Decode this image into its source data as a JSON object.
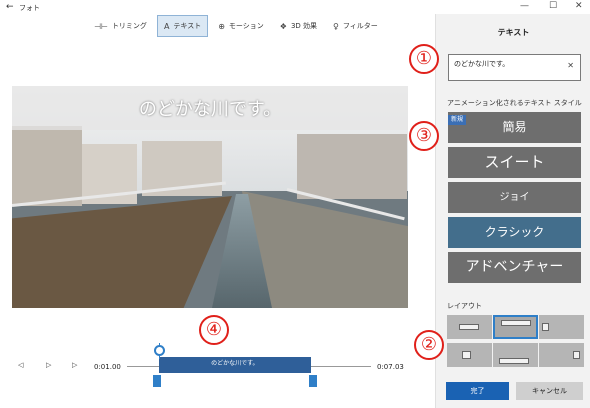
{
  "window": {
    "title": "フォト",
    "back_glyph": "←",
    "minimize": "—",
    "maximize": "☐",
    "close": "✕"
  },
  "toolbar": {
    "items": [
      {
        "label": "トリミング",
        "icon": "trim-icon"
      },
      {
        "label": "テキスト",
        "icon": "text-icon"
      },
      {
        "label": "モーション",
        "icon": "motion-icon"
      },
      {
        "label": "3D 効果",
        "icon": "3d-effects-icon"
      },
      {
        "label": "フィルター",
        "icon": "filter-icon"
      }
    ],
    "active": "テキスト"
  },
  "preview": {
    "caption": "のどかな川です。"
  },
  "timeline": {
    "start_time": "0:01.00",
    "end_time": "0:07.03",
    "clip_label": "のどかな川です。",
    "prev_glyph": "◁",
    "play_glyph": "▷",
    "next_glyph": "▷",
    "range": [
      0.0,
      7.03
    ],
    "text_start": 1.0,
    "text_end": 5.3
  },
  "annotations": [
    "①",
    "②",
    "③",
    "④"
  ],
  "panel": {
    "title": "テキスト",
    "text_value": "のどかな川です。",
    "clear_glyph": "✕",
    "styles_label": "アニメーション化されるテキスト スタイル",
    "new_badge": "新規",
    "styles": [
      "簡易",
      "スイート",
      "ジョイ",
      "クラシック",
      "アドベンチャー"
    ],
    "selected_style": "クラシック",
    "layout_label": "レイアウト",
    "done_label": "完了",
    "cancel_label": "キャンセル"
  },
  "colors": {
    "accent": "#1a62b3",
    "annotation": "#e0201a",
    "selected_style": "#436e8c"
  }
}
